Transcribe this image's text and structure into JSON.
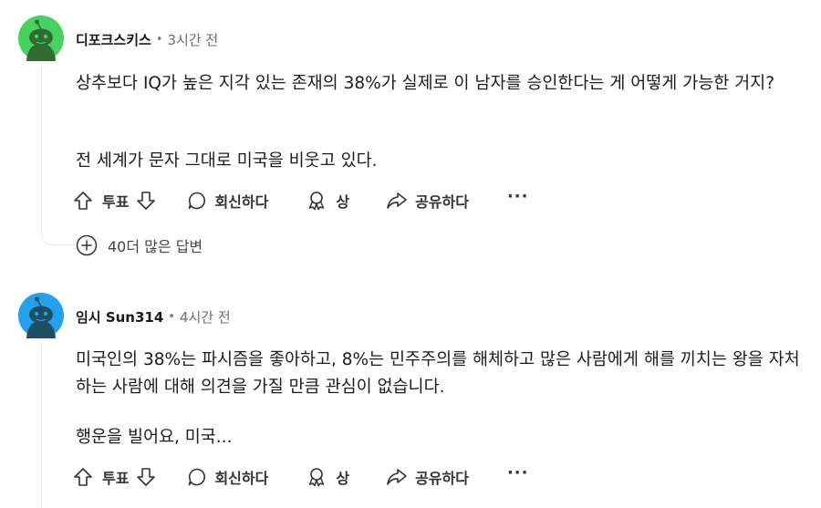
{
  "comments": [
    {
      "author": "디포크스키스",
      "time": "3시간 전",
      "avatar_color": "#46d160",
      "paragraphs": [
        "상추보다 IQ가 높은 지각 있는 존재의 38%가 실제로 이 남자를 승인한다는 게 어떻게 가능한 거지?",
        "전 세계가 문자 그대로 미국을 비웃고 있다."
      ],
      "actions": {
        "vote_label": "투표",
        "reply_label": "회신하다",
        "award_label": "상",
        "share_label": "공유하다",
        "more_label": "···"
      },
      "more_replies_label": "40더 많은 답변"
    },
    {
      "author": "임시 Sun314",
      "time": "4시간 전",
      "avatar_color": "#24a0ed",
      "paragraphs": [
        "미국인의 38%는 파시즘을 좋아하고, 8%는 민주주의를 해체하고 많은 사람에게 해를 끼치는 왕을 자처하는 사람에 대해 의견을 가질 만큼 관심이 없습니다.",
        "행운을 빌어요, 미국..."
      ],
      "actions": {
        "vote_label": "투표",
        "reply_label": "회신하다",
        "award_label": "상",
        "share_label": "공유하다",
        "more_label": "···"
      }
    }
  ],
  "colors": {
    "thread_line": "#e5e7ea",
    "text": "#1c1c1c",
    "meta": "#6e6e6e"
  },
  "icons": {
    "upvote": "arrow-up-outline-icon",
    "downvote": "arrow-down-outline-icon",
    "reply": "speech-bubble-icon",
    "award": "award-ribbon-icon",
    "share": "share-arrow-icon",
    "expand": "plus-circle-icon"
  }
}
